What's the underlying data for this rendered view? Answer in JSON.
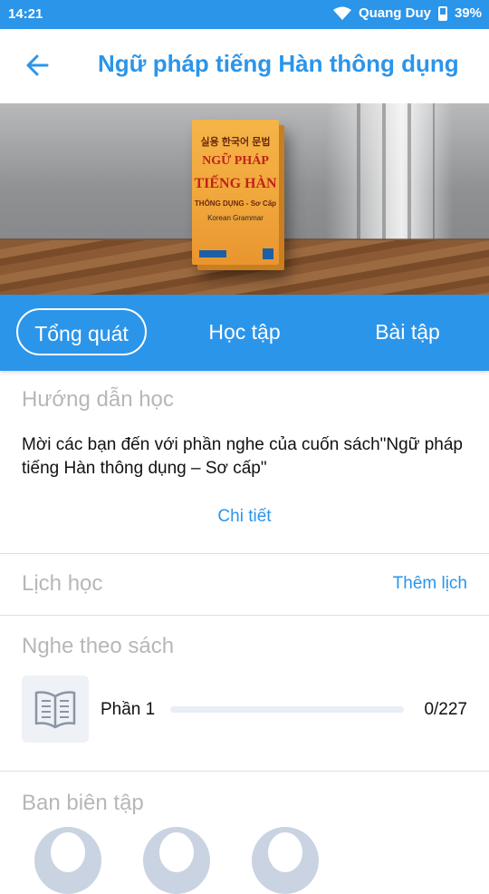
{
  "status_bar": {
    "time": "14:21",
    "carrier": "Quang Duy",
    "battery": "39%"
  },
  "app_bar": {
    "title": "Ngữ pháp tiếng Hàn thông dụng"
  },
  "banner": {
    "book_cover": {
      "korean_title": "실용 한국어 문법",
      "title_line1": "NGỮ PHÁP",
      "title_line2": "TIẾNG HÀN",
      "subtitle": "THÔNG DỤNG - Sơ Cấp",
      "english": "Korean Grammar"
    }
  },
  "tabs": [
    {
      "label": "Tổng quát",
      "active": true
    },
    {
      "label": "Học tập",
      "active": false
    },
    {
      "label": "Bài tập",
      "active": false
    }
  ],
  "guide": {
    "title": "Hướng dẫn học",
    "text": "Mời các bạn đến với phần nghe của cuốn sách\"Ngữ pháp tiếng Hàn thông dụng – Sơ cấp\"",
    "detail_link": "Chi tiết"
  },
  "schedule": {
    "title": "Lịch học",
    "add_link": "Thêm lịch"
  },
  "listening": {
    "title": "Nghe theo sách",
    "items": [
      {
        "label": "Phần 1",
        "progress_text": "0/227",
        "progress": 0
      }
    ]
  },
  "editors": {
    "title": "Ban biên tập",
    "avatar_count": 3
  },
  "colors": {
    "accent": "#2b95ea",
    "muted": "#b7b7b7"
  }
}
